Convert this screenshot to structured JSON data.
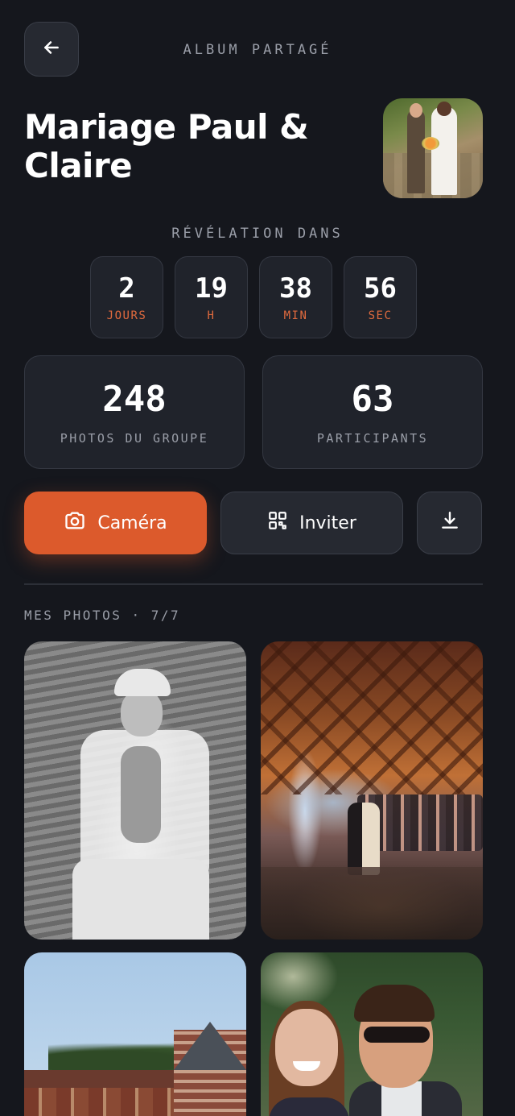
{
  "header": {
    "back_icon": "arrow-left-icon",
    "label": "ALBUM PARTAGÉ"
  },
  "album": {
    "title": "Mariage Paul & Claire"
  },
  "countdown": {
    "label": "RÉVÉLATION DANS",
    "items": [
      {
        "value": "2",
        "unit": "JOURS"
      },
      {
        "value": "19",
        "unit": "H"
      },
      {
        "value": "38",
        "unit": "MIN"
      },
      {
        "value": "56",
        "unit": "SEC"
      }
    ]
  },
  "stats": [
    {
      "value": "248",
      "label": "PHOTOS DU GROUPE"
    },
    {
      "value": "63",
      "label": "PARTICIPANTS"
    }
  ],
  "actions": {
    "camera_label": "Caméra",
    "camera_icon": "camera-icon",
    "invite_label": "Inviter",
    "invite_icon": "qr-code-icon",
    "download_icon": "download-icon"
  },
  "my_photos": {
    "label": "MES PHOTOS · 7/7"
  },
  "colors": {
    "background": "#15171d",
    "accent": "#dc5a2c",
    "card": "#20232b"
  }
}
